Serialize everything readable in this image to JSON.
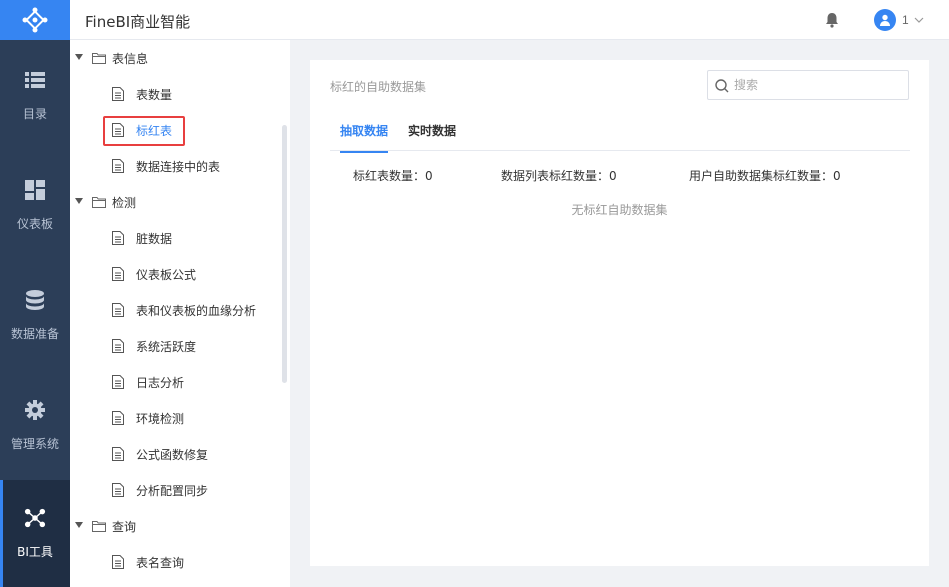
{
  "app": {
    "title": "FineBI商业智能"
  },
  "header": {
    "username": "1"
  },
  "nav": [
    {
      "label": "目录",
      "icon": "list-icon"
    },
    {
      "label": "仪表板",
      "icon": "dashboard-icon"
    },
    {
      "label": "数据准备",
      "icon": "database-icon"
    },
    {
      "label": "管理系统",
      "icon": "gear-icon"
    },
    {
      "label": "BI工具",
      "icon": "network-icon",
      "active": true
    }
  ],
  "tree": {
    "groups": [
      {
        "label": "表信息",
        "items": [
          "表数量",
          "标红表",
          "数据连接中的表"
        ]
      },
      {
        "label": "检测",
        "items": [
          "脏数据",
          "仪表板公式",
          "表和仪表板的血缘分析",
          "系统活跃度",
          "日志分析",
          "环境检测",
          "公式函数修复",
          "分析配置同步"
        ]
      },
      {
        "label": "查询",
        "items": [
          "表名查询"
        ]
      }
    ],
    "selected": "标红表"
  },
  "main": {
    "title": "标红的自助数据集",
    "search_placeholder": "搜索",
    "tabs": [
      "抽取数据",
      "实时数据"
    ],
    "stats": [
      "标红表数量：0",
      "数据列表标红数量：0",
      "用户自助数据集标红数量：0"
    ],
    "empty_text": "无标红自助数据集"
  },
  "colors": {
    "accent": "#3685f2",
    "nav_bg": "#2c3e58",
    "highlight": "#e83f3f"
  }
}
